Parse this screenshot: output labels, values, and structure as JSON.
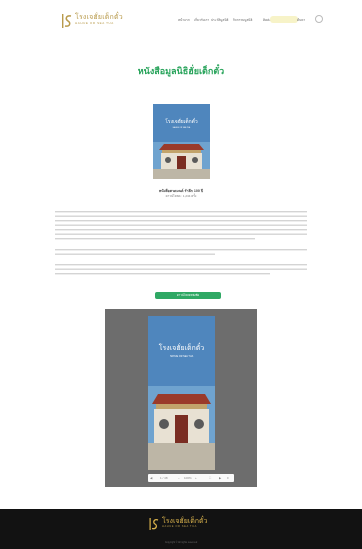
{
  "header": {
    "logo_text": "โรงเจฮั่ยเต็กตั๋ว",
    "logo_sub": "HAHUE OR SEA TUA",
    "nav": [
      "หน้าแรก",
      "เกี่ยวกับเรา",
      "ประวัติมูลนิธิ",
      "กิจกรรมมูลนิธิ",
      "ติดต่อเรา"
    ],
    "nav_button": "",
    "search_label": "ค้นหา"
  },
  "page": {
    "title": "หนังสือมูลนิธิฮั่ยเต็กตั๋ว",
    "caption_title": "หนังสือสวดมนต์ รำลึก 100 ปี",
    "caption_sub": "ดาวน์โหลด : 1,234 ครั้ง",
    "download_button": "ดาวน์โหลดหนังสือ"
  },
  "cover": {
    "title": "โรงเจฮั่ยเต็กตั๋ว",
    "subtitle": "HAHUE OR SEA TUA"
  },
  "viewer": {
    "page_counter": "1 / 48",
    "zoom": "100%"
  },
  "footer": {
    "logo_text": "โรงเจฮั่ยเต็กตั๋ว",
    "logo_sub": "HAHUE OR SEA TUA",
    "copyright": "Copyright © All rights reserved"
  },
  "colors": {
    "brand_gold": "#b89a4b",
    "title_green": "#27a35a",
    "button_green": "#2fa864",
    "footer_bg": "#121212",
    "viewer_bg": "#6d6d6d"
  }
}
